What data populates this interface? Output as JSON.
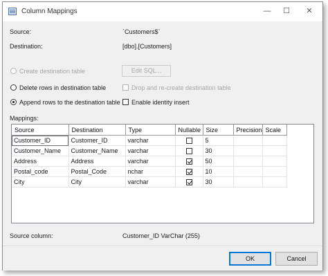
{
  "window": {
    "title": "Column Mappings",
    "buttons": {
      "minimize": "—",
      "maximize": "☐",
      "close": "✕"
    }
  },
  "info": {
    "source_label": "Source:",
    "source_value": "`Customers$`",
    "destination_label": "Destination:",
    "destination_value": "[dbo].[Customers]"
  },
  "options": {
    "create_table": {
      "label": "Create destination table",
      "selected": false,
      "enabled": false
    },
    "edit_sql": {
      "label": "Edit SQL...",
      "enabled": false
    },
    "delete_rows": {
      "label": "Delete rows in destination table",
      "selected": false,
      "enabled": true
    },
    "drop_recreate": {
      "label": "Drop and re-create destination table",
      "checked": false,
      "enabled": false
    },
    "append_rows": {
      "label": "Append rows to the destination table",
      "selected": true,
      "enabled": true
    },
    "identity_insert": {
      "label": "Enable identity insert",
      "checked": false,
      "enabled": true
    }
  },
  "mappings": {
    "label": "Mappings:",
    "columns": [
      "Source",
      "Destination",
      "Type",
      "Nullable",
      "Size",
      "Precision",
      "Scale"
    ],
    "rows": [
      {
        "source": "Customer_ID",
        "destination": "Customer_ID",
        "type": "varchar",
        "nullable": false,
        "size": "5",
        "precision": "",
        "scale": ""
      },
      {
        "source": "Customer_Name",
        "destination": "Customer_Name",
        "type": "varchar",
        "nullable": false,
        "size": "30",
        "precision": "",
        "scale": ""
      },
      {
        "source": "Address",
        "destination": "Address",
        "type": "varchar",
        "nullable": true,
        "size": "50",
        "precision": "",
        "scale": ""
      },
      {
        "source": "Postal_code",
        "destination": "Postal_Code",
        "type": "nchar",
        "nullable": true,
        "size": "10",
        "precision": "",
        "scale": ""
      },
      {
        "source": "City",
        "destination": "City",
        "type": "varchar",
        "nullable": true,
        "size": "30",
        "precision": "",
        "scale": ""
      }
    ]
  },
  "source_column": {
    "label": "Source column:",
    "value": "Customer_ID VarChar (255)"
  },
  "footer": {
    "ok": "OK",
    "cancel": "Cancel"
  }
}
